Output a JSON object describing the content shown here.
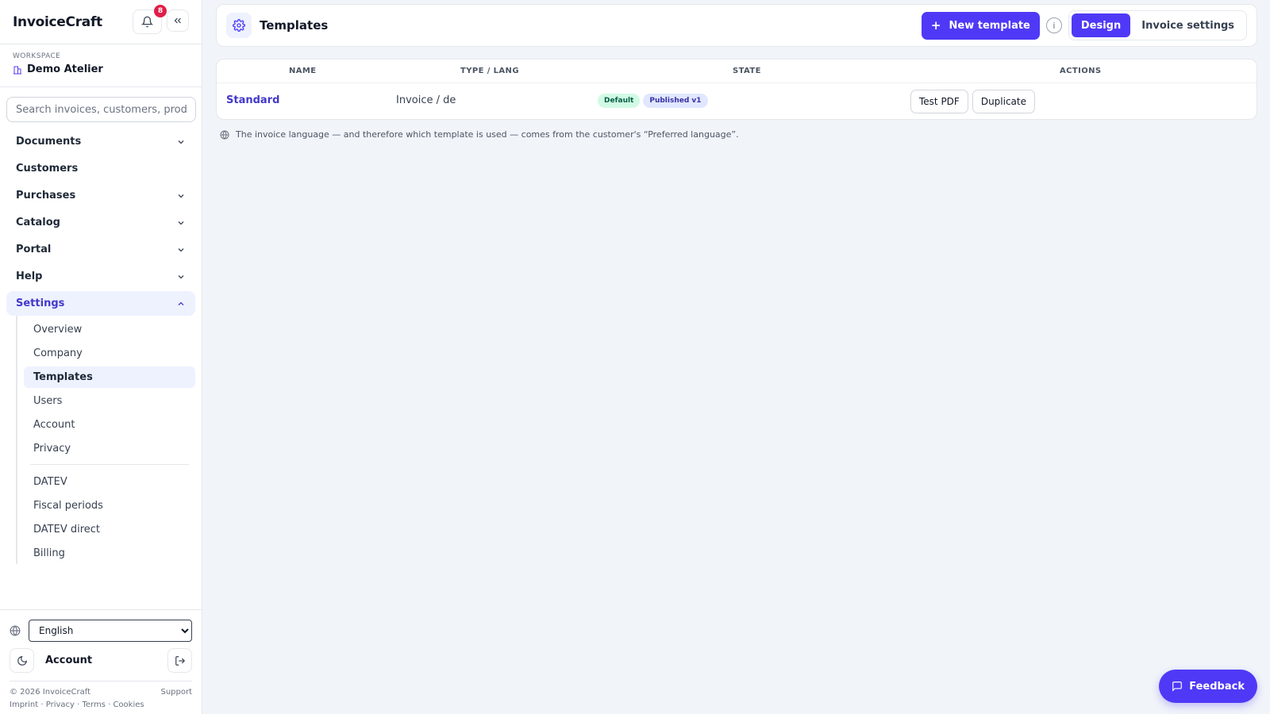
{
  "brand": "InvoiceCraft",
  "notifications": {
    "count": "8"
  },
  "workspace": {
    "label": "WORKSPACE",
    "name": "Demo Atelier"
  },
  "search": {
    "placeholder": "Search invoices, customers, products"
  },
  "sidebar": {
    "items": [
      {
        "label": "Documents",
        "icon": "chevron-down-icon"
      },
      {
        "label": "Customers"
      },
      {
        "label": "Purchases",
        "icon": "chevron-down-icon"
      },
      {
        "label": "Catalog",
        "icon": "chevron-down-icon"
      },
      {
        "label": "Portal",
        "icon": "chevron-down-icon"
      },
      {
        "label": "Help",
        "icon": "chevron-down-icon"
      },
      {
        "label": "Settings",
        "icon": "chevron-up-icon",
        "active": true
      }
    ],
    "settings_sub": [
      "Overview",
      "Company",
      "Templates",
      "Users",
      "Account",
      "Privacy",
      "DATEV",
      "Fiscal periods",
      "DATEV direct",
      "Billing"
    ],
    "active_sub": "Templates"
  },
  "bottom": {
    "language": "English",
    "account_label": "Account",
    "copyright": "© 2026 InvoiceCraft",
    "support": "Support",
    "links": "Imprint · Privacy · Terms · Cookies"
  },
  "header": {
    "title": "Templates",
    "new_template": "New template",
    "seg_design": "Design",
    "seg_settings": "Invoice settings"
  },
  "table": {
    "columns": [
      "NAME",
      "TYPE / LANG",
      "STATE",
      "ACTIONS"
    ],
    "rows": [
      {
        "name": "Standard",
        "type_lang": "Invoice / de",
        "badges": [
          "Default",
          "Published v1"
        ],
        "actions": [
          "Test PDF",
          "Duplicate"
        ]
      }
    ]
  },
  "note": "The invoice language — and therefore which template is used — comes from the customer's “Preferred language”.",
  "feedback": "Feedback",
  "colors": {
    "accent": "#4f39f6",
    "badge": "#e11d48",
    "background": "#f1f4f9"
  }
}
